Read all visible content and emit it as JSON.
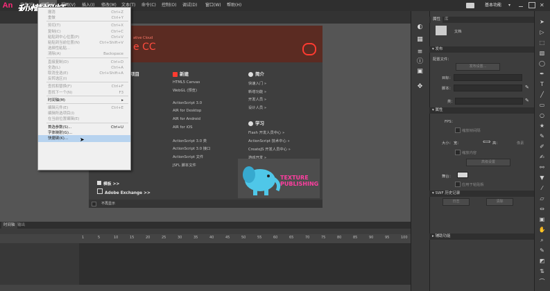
{
  "app": {
    "logo": "An",
    "brand_watermark": "秒懂视频"
  },
  "menubar": {
    "items": [
      "文件(F)",
      "编辑(E)",
      "视图(V)",
      "插入(I)",
      "修改(M)",
      "文本(T)",
      "命令(C)",
      "控制(O)",
      "调试(D)",
      "窗口(W)",
      "帮助(H)"
    ],
    "workspace": "基本功能"
  },
  "edit_menu": {
    "items": [
      {
        "label": "撤消",
        "shortcut": "Ctrl+Z",
        "disabled": true
      },
      {
        "label": "重做",
        "shortcut": "Ctrl+Y",
        "disabled": true
      },
      {
        "sep": true
      },
      {
        "label": "剪切(T)",
        "shortcut": "Ctrl+X",
        "disabled": true
      },
      {
        "label": "复制(C)",
        "shortcut": "Ctrl+C",
        "disabled": true
      },
      {
        "label": "粘贴到中心位置(P)",
        "shortcut": "Ctrl+V",
        "disabled": true
      },
      {
        "label": "粘贴到当前位置(N)",
        "shortcut": "Ctrl+Shift+V",
        "disabled": true
      },
      {
        "label": "选择性粘贴...",
        "shortcut": "",
        "disabled": true
      },
      {
        "label": "清除(A)",
        "shortcut": "Backspace",
        "disabled": true
      },
      {
        "sep": true
      },
      {
        "label": "直接复制(D)",
        "shortcut": "Ctrl+D",
        "disabled": true
      },
      {
        "label": "全选(L)",
        "shortcut": "Ctrl+A",
        "disabled": true
      },
      {
        "label": "取消全选(E)",
        "shortcut": "Ctrl+Shift+A",
        "disabled": true
      },
      {
        "label": "反转选区(I)",
        "shortcut": "",
        "disabled": true
      },
      {
        "sep": true
      },
      {
        "label": "查找和替换(F)",
        "shortcut": "Ctrl+F",
        "disabled": true
      },
      {
        "label": "查找下一个(N)",
        "shortcut": "F3",
        "disabled": true
      },
      {
        "sep": true
      },
      {
        "label": "时间轴(M)",
        "shortcut": "▸",
        "disabled": false
      },
      {
        "sep": true
      },
      {
        "label": "编辑元件(E)",
        "shortcut": "Ctrl+E",
        "disabled": true
      },
      {
        "label": "编辑所选项目(I)",
        "shortcut": "",
        "disabled": true
      },
      {
        "label": "在当前位置编辑(E)",
        "shortcut": "",
        "disabled": true
      },
      {
        "sep": true
      },
      {
        "label": "首选参数(S)...",
        "shortcut": "Ctrl+U",
        "disabled": false
      },
      {
        "label": "字体映射(G)...",
        "shortcut": "",
        "disabled": false
      },
      {
        "label": "快捷键(K)...",
        "shortcut": "",
        "disabled": false,
        "selected": true
      }
    ]
  },
  "welcome": {
    "cloud_small": "ative Cloud",
    "cc_title": "e CC",
    "col1_header": "项目",
    "col2": {
      "header": "新建",
      "items": [
        "HTML5 Canvas",
        "WebGL (预览)",
        "",
        "ActionScript 3.0",
        "AIR for Desktop",
        "AIR for Android",
        "AIR for iOS",
        "",
        "ActionScript 3.0 类",
        "ActionScript 3.0 接口",
        "ActionScript 文件",
        "JSFL 脚本文件"
      ]
    },
    "col3": {
      "header": "简介",
      "items": [
        "快速入门 »",
        "新增功能 »",
        "开发人员 »",
        "设计人员 »"
      ]
    },
    "col4": {
      "header": "学习",
      "items": [
        "Flash 开发人员中心 »",
        "ActionScript 技术中心 »",
        "CreateJS 开发人员中心 »",
        "游戏开发 »"
      ]
    },
    "templates": "模板 >>",
    "exchange": "Adobe Exchange >>",
    "promo": "TEXTURE PUBLISHING",
    "dont_show": "不再显示"
  },
  "timeline": {
    "tabs": [
      "时间轴",
      "输出"
    ],
    "frames": [
      "1",
      "5",
      "10",
      "15",
      "20",
      "25",
      "30",
      "35",
      "40",
      "45",
      "50",
      "55",
      "60",
      "65",
      "70",
      "75",
      "80",
      "85",
      "90",
      "95",
      "100"
    ]
  },
  "properties": {
    "tabs": [
      "属性",
      "库"
    ],
    "doc_label": "文档",
    "publish": {
      "section": "发布",
      "profile_label": "配置文件：",
      "publish_settings": "发布设置...",
      "target_label": "目标：",
      "script_label": "脚本：",
      "class_label": "类："
    },
    "attrs": {
      "section": "属性",
      "fps_label": "FPS：",
      "scale_span": "缩放帧间隔",
      "size_label": "大小：",
      "width_label": "宽：",
      "height_label": "高：",
      "px": "像素",
      "scale_content": "缩放内容",
      "advanced": "高级设置",
      "stage_label": "舞台：",
      "apply_full": "应用于粘贴板"
    },
    "swf": {
      "section": "SWF 历史记录",
      "log": "日志",
      "clear": "清除"
    },
    "accessibility": {
      "section": "辅助功能"
    }
  }
}
